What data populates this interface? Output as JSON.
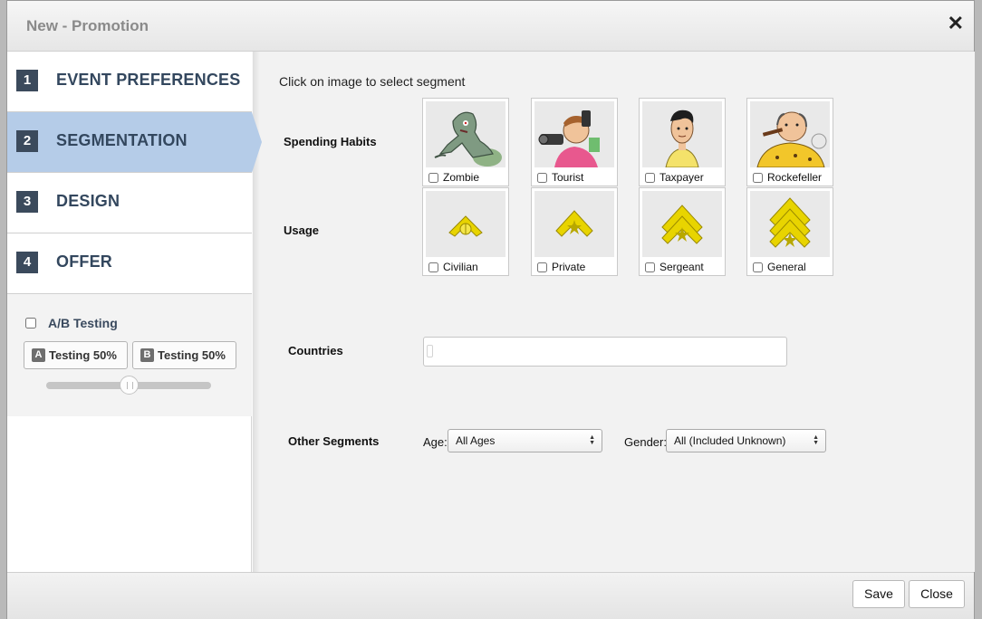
{
  "modal": {
    "title": "New - Promotion",
    "close_glyph": "✕"
  },
  "steps": [
    {
      "num": "1",
      "label": "EVENT PREFERENCES"
    },
    {
      "num": "2",
      "label": "SEGMENTATION"
    },
    {
      "num": "3",
      "label": "DESIGN"
    },
    {
      "num": "4",
      "label": "OFFER"
    }
  ],
  "active_step": 2,
  "ab_testing": {
    "label": "A/B Testing",
    "checked": false,
    "a": {
      "letter": "A",
      "label": "Testing 50%"
    },
    "b": {
      "letter": "B",
      "label": "Testing 50%"
    },
    "slider_value_percent": 50
  },
  "segmentation": {
    "instruction": "Click on image to select segment",
    "spending_label": "Spending Habits",
    "spending": [
      {
        "name": "Zombie",
        "icon": "zombie-icon"
      },
      {
        "name": "Tourist",
        "icon": "tourist-icon"
      },
      {
        "name": "Taxpayer",
        "icon": "taxpayer-icon"
      },
      {
        "name": "Rockefeller",
        "icon": "rockefeller-icon"
      }
    ],
    "usage_label": "Usage",
    "usage": [
      {
        "name": "Civilian",
        "icon": "civilian-rank-icon"
      },
      {
        "name": "Private",
        "icon": "private-rank-icon"
      },
      {
        "name": "Sergeant",
        "icon": "sergeant-rank-icon"
      },
      {
        "name": "General",
        "icon": "general-rank-icon"
      }
    ],
    "countries_label": "Countries",
    "countries_value": "",
    "other_label": "Other Segments",
    "age_label": "Age:",
    "age_value": "All Ages",
    "gender_label": "Gender:",
    "gender_value": "All (Included Unknown)"
  },
  "footer": {
    "save_label": "Save",
    "close_label": "Close"
  },
  "colors": {
    "active_step_bg": "#b5cce8",
    "step_number_bg": "#3b4a5c",
    "step_label": "#33475e",
    "rank_gold": "#e8d400"
  }
}
